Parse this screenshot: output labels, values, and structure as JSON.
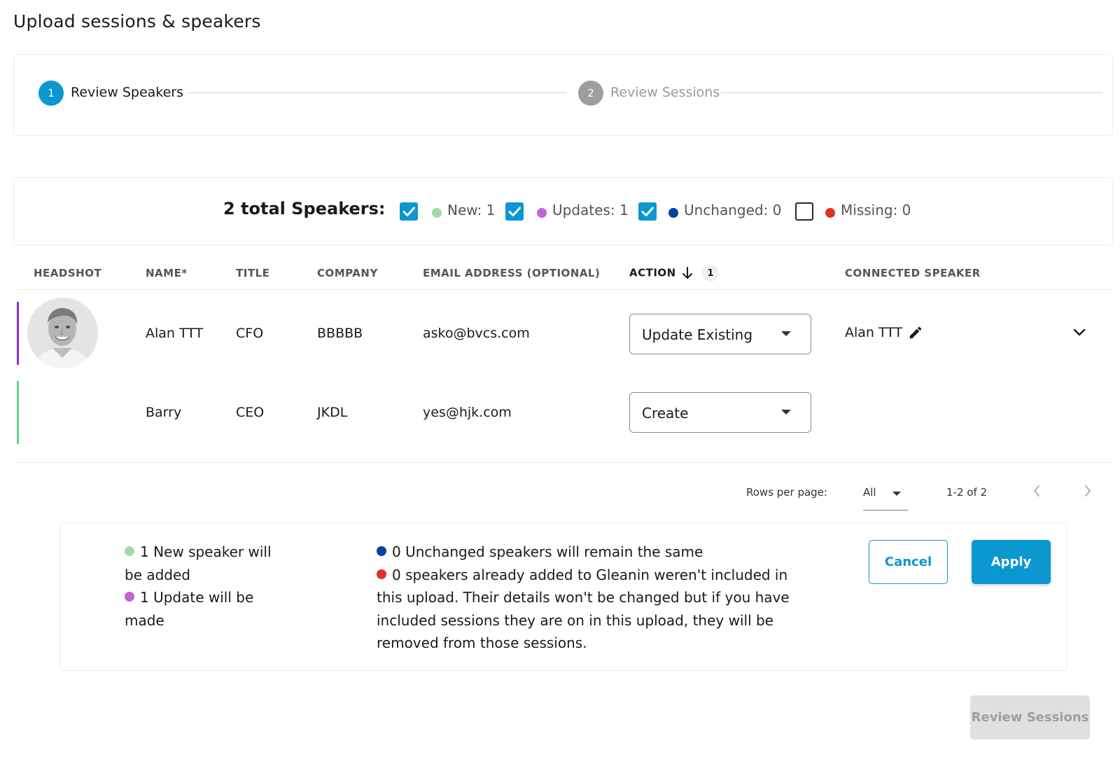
{
  "page": {
    "title": "Upload sessions & speakers"
  },
  "stepper": {
    "steps": [
      {
        "number": "1",
        "label": "Review Speakers",
        "state": "active"
      },
      {
        "number": "2",
        "label": "Review Sessions",
        "state": "inactive"
      }
    ]
  },
  "filters": {
    "total_label": "2 total Speakers:",
    "items": [
      {
        "label": "New: 1",
        "checked": true,
        "color": "#a5d9a8"
      },
      {
        "label": "Updates: 1",
        "checked": true,
        "color": "#c064d6"
      },
      {
        "label": "Unchanged: 0",
        "checked": true,
        "color": "#0d3fa3"
      },
      {
        "label": "Missing: 0",
        "checked": false,
        "color": "#e0302c"
      }
    ]
  },
  "table": {
    "columns": {
      "headshot": "HEADSHOT",
      "name": "NAME*",
      "title": "TITLE",
      "company": "COMPANY",
      "email": "EMAIL ADDRESS (OPTIONAL)",
      "action": "ACTION",
      "action_sort_badge": "1",
      "connected": "CONNECTED SPEAKER"
    },
    "rows": [
      {
        "name": "Alan TTT",
        "title": "CFO",
        "company": "BBBBB",
        "email": "asko@bvcs.com",
        "action": "Update Existing",
        "connected": "Alan TTT",
        "status_color": "#8e2fd6",
        "has_headshot": true
      },
      {
        "name": "Barry",
        "title": "CEO",
        "company": "JKDL",
        "email": "yes@hjk.com",
        "action": "Create",
        "connected": "",
        "status_color": "#5cd68a",
        "has_headshot": false
      }
    ]
  },
  "pagination": {
    "rows_per_page_label": "Rows per page:",
    "rows_per_page_value": "All",
    "range": "1-2 of 2"
  },
  "summary": {
    "new_text": "1 New speaker will be added",
    "updates_text": "1 Update will be made",
    "unchanged_text": "0 Unchanged speakers will remain the same",
    "missing_text": "0 speakers already added to Gleanin weren't included in this upload. Their details won't be changed but if you have included sessions they are on in this upload, they will be removed from those sessions.",
    "cancel_label": "Cancel",
    "apply_label": "Apply"
  },
  "footer": {
    "next_label": "Review Sessions"
  },
  "colors": {
    "accent": "#0b97d0",
    "new": "#a5d9a8",
    "updates": "#c064d6",
    "unchanged": "#0d3fa3",
    "missing": "#e0302c"
  }
}
